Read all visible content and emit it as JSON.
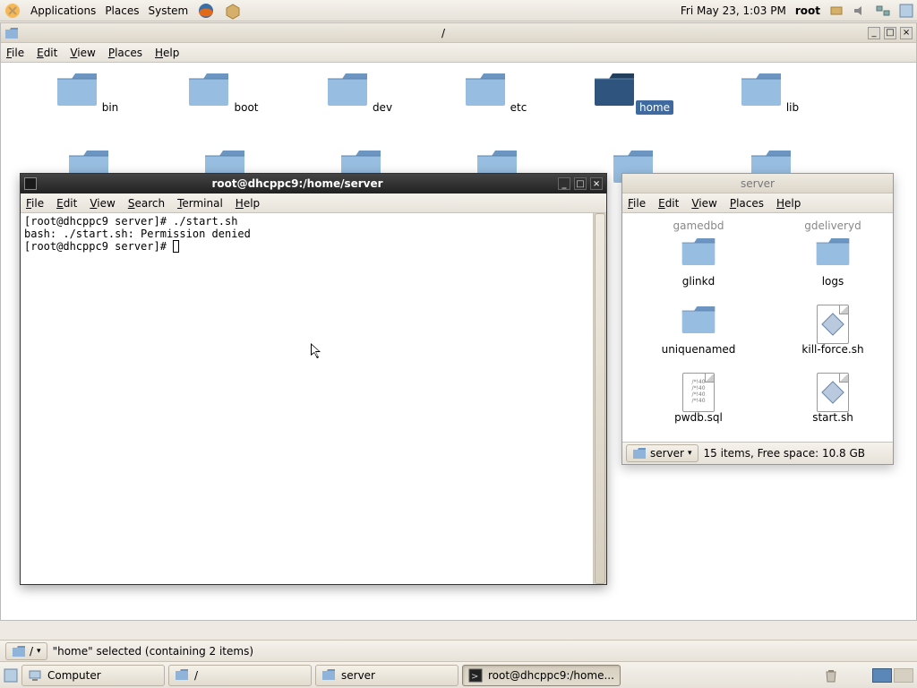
{
  "top_panel": {
    "apps": "Applications",
    "places": "Places",
    "system": "System",
    "clock": "Fri May 23,  1:03 PM",
    "user": "root"
  },
  "nautilus_root": {
    "title": "/",
    "menu": {
      "file": "File",
      "edit": "Edit",
      "view": "View",
      "places": "Places",
      "help": "Help"
    },
    "folders": [
      "bin",
      "boot",
      "dev",
      "etc",
      "home",
      "lib"
    ],
    "selected": "home",
    "path_button": "/",
    "status": "\"home\" selected (containing 2 items)"
  },
  "terminal": {
    "title": "root@dhcppc9:/home/server",
    "menu": {
      "file": "File",
      "edit": "Edit",
      "view": "View",
      "search": "Search",
      "terminal": "Terminal",
      "help": "Help"
    },
    "line1": "[root@dhcppc9 server]# ./start.sh",
    "line2": "bash: ./start.sh: Permission denied",
    "line3": "[root@dhcppc9 server]# "
  },
  "nautilus_server": {
    "title": "server",
    "menu": {
      "file": "File",
      "edit": "Edit",
      "view": "View",
      "places": "Places",
      "help": "Help"
    },
    "items": [
      {
        "name": "gamedbd",
        "type": "folder",
        "partial": true
      },
      {
        "name": "gdeliveryd",
        "type": "folder",
        "partial": true
      },
      {
        "name": "glinkd",
        "type": "folder"
      },
      {
        "name": "logs",
        "type": "folder"
      },
      {
        "name": "uniquenamed",
        "type": "folder"
      },
      {
        "name": "kill-force.sh",
        "type": "script"
      },
      {
        "name": "pwdb.sql",
        "type": "sql"
      },
      {
        "name": "start.sh",
        "type": "script"
      }
    ],
    "location_btn": "server",
    "status": "15 items, Free space: 10.8 GB"
  },
  "taskbar": {
    "computer": "Computer",
    "slash": "/",
    "server": "server",
    "terminal": "root@dhcppc9:/home..."
  }
}
